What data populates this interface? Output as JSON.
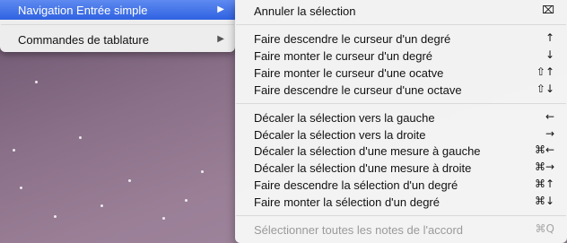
{
  "parent_menu": {
    "items": [
      {
        "label": "Navigation Entrée simple",
        "arrow": "▶",
        "selected": true
      },
      {
        "label": "Commandes de tablature",
        "arrow": "▶",
        "selected": false
      }
    ]
  },
  "submenu": {
    "items": [
      {
        "label": "Annuler la sélection",
        "shortcut": "⌧"
      },
      {
        "label": "Faire descendre le curseur d'un degré",
        "shortcut": "↑"
      },
      {
        "label": "Faire monter le curseur d'un degré",
        "shortcut": "↓"
      },
      {
        "label": "Faire monter le curseur d'une ocatve",
        "shortcut": "⇧↑"
      },
      {
        "label": "Faire descendre le curseur d'une octave",
        "shortcut": "⇧↓"
      },
      {
        "label": "Décaler la sélection vers la gauche",
        "shortcut": "←"
      },
      {
        "label": "Décaler la sélection vers la droite",
        "shortcut": "→"
      },
      {
        "label": "Décaler la sélection d'une mesure à gauche",
        "shortcut": "⌘←"
      },
      {
        "label": "Décaler la sélection d'une mesure à droite",
        "shortcut": "⌘→"
      },
      {
        "label": "Faire descendre la sélection d'un degré",
        "shortcut": "⌘↑"
      },
      {
        "label": "Faire monter la sélection d'un degré",
        "shortcut": "⌘↓"
      },
      {
        "label": "Sélectionner toutes les notes de l'accord",
        "shortcut": "⌘Q",
        "disabled": true
      }
    ]
  },
  "colors": {
    "selection": "#3d6fe8",
    "menu_bg": "#f5f5f5",
    "disabled_text": "#9a9a9a"
  }
}
